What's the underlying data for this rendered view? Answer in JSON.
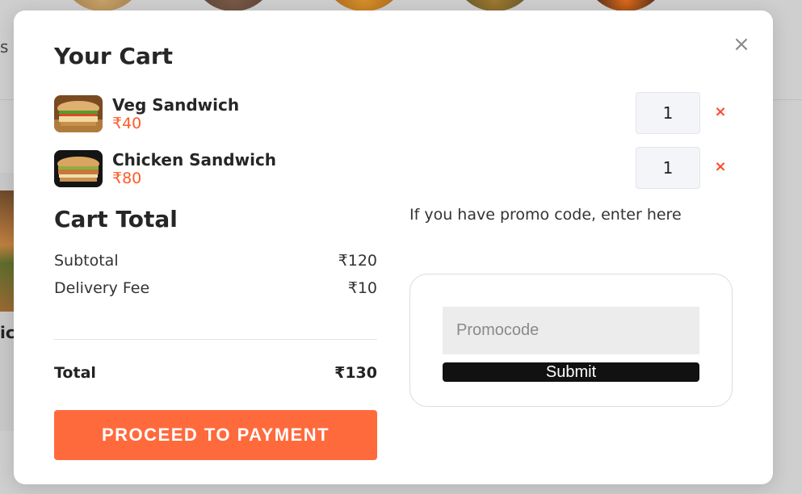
{
  "background": {
    "partial_text_left": "s",
    "partial_text_left2": "ic"
  },
  "cart": {
    "title": "Your Cart",
    "items": [
      {
        "name": "Veg Sandwich",
        "price": "₹40",
        "quantity": "1",
        "image": "veg-sandwich-image"
      },
      {
        "name": "Chicken Sandwich",
        "price": "₹80",
        "quantity": "1",
        "image": "chicken-sandwich-image"
      }
    ],
    "remove_icon": "×",
    "close_icon": "×"
  },
  "totals": {
    "title": "Cart Total",
    "subtotal_label": "Subtotal",
    "subtotal_value": "₹120",
    "delivery_label": "Delivery Fee",
    "delivery_value": "₹10",
    "total_label": "Total",
    "total_value": "₹130"
  },
  "checkout": {
    "button_label": "PROCEED TO PAYMENT"
  },
  "promo": {
    "hint": "If you have promo code, enter here",
    "placeholder": "Promocode",
    "value": "",
    "submit_label": "Submit"
  },
  "colors": {
    "accent": "#ff6a3d",
    "price": "#ff5a2a",
    "remove": "#ff4a2a"
  }
}
